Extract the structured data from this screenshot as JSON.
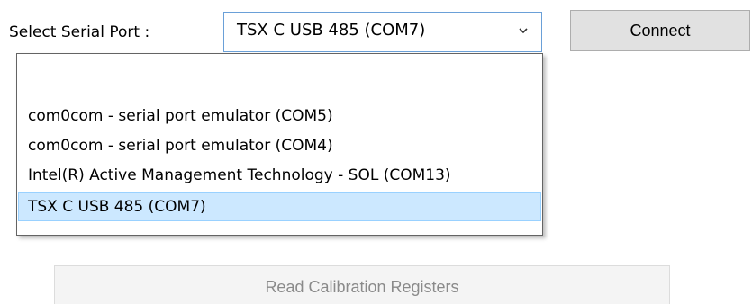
{
  "serial": {
    "label": "Select Serial Port :",
    "selected_value": "TSX C USB 485 (COM7)",
    "dropdown_icon": "chevron-down-icon",
    "options": [
      "com0com - serial port emulator (COM5)",
      "com0com - serial port emulator (COM4)",
      "Intel(R) Active Management Technology - SOL (COM13)",
      "TSX C USB 485 (COM7)"
    ]
  },
  "buttons": {
    "connect": "Connect",
    "read_calibration": "Read Calibration Registers"
  },
  "colors": {
    "selection_background": "#cce8ff",
    "focus_border": "#6aa0d8",
    "disabled_text": "#8a8a8a"
  }
}
